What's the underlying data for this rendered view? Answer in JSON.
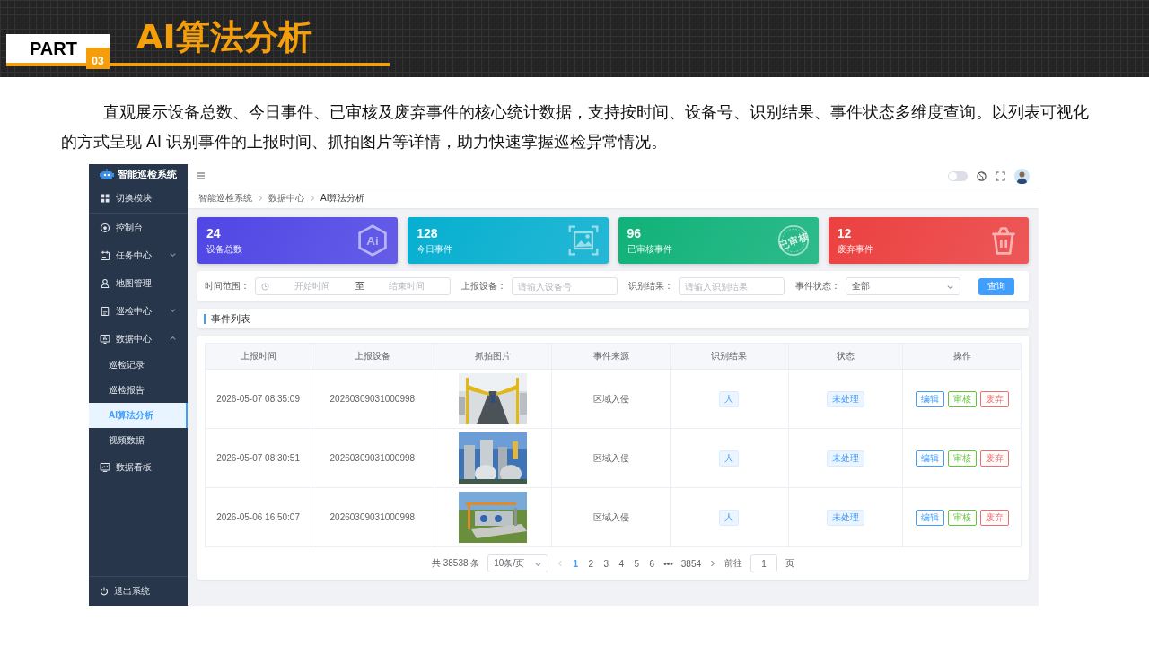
{
  "slide": {
    "part_label": "PART",
    "part_number": "03",
    "title": "AI算法分析",
    "description": "直观展示设备总数、今日事件、已审核及废弃事件的核心统计数据，支持按时间、设备号、识别结果、事件状态多维度查询。以列表可视化的方式呈现 AI 识别事件的上报时间、抓拍图片等详情，助力快速掌握巡检异常情况。"
  },
  "app": {
    "logo": "智能巡检系统",
    "menu": [
      {
        "label": "切换模块",
        "kind": "switch",
        "selected": false
      },
      {
        "label": "控制台",
        "kind": "link",
        "selected": false
      },
      {
        "label": "任务中心",
        "kind": "group",
        "expanded": false,
        "selected": false
      },
      {
        "label": "地图管理",
        "kind": "link",
        "selected": false
      },
      {
        "label": "巡检中心",
        "kind": "group",
        "expanded": false,
        "selected": false
      },
      {
        "label": "数据中心",
        "kind": "group",
        "expanded": true,
        "selected": false,
        "children": [
          {
            "label": "巡检记录",
            "selected": false
          },
          {
            "label": "巡检报告",
            "selected": false
          },
          {
            "label": "AI算法分析",
            "selected": true
          },
          {
            "label": "视频数据",
            "selected": false
          }
        ]
      },
      {
        "label": "数据看板",
        "kind": "link",
        "selected": false
      }
    ],
    "logout": "退出系统",
    "theme_switch": {
      "on": false
    },
    "breadcrumb": [
      "智能巡检系统",
      "数据中心",
      "AI算法分析"
    ],
    "stats": [
      {
        "value": "24",
        "label": "设备总数",
        "color": "#4f46e5",
        "icon_text": "Ai"
      },
      {
        "value": "128",
        "label": "今日事件",
        "color": "#06afd0"
      },
      {
        "value": "96",
        "label": "已审核事件",
        "color": "#10b27a",
        "icon_text": "已审核"
      },
      {
        "value": "12",
        "label": "废弃事件",
        "color": "#ec4040"
      }
    ],
    "filters": [
      {
        "kind": "daterange",
        "label": "时间范围：",
        "start_placeholder": "开始时间",
        "separator": "至",
        "end_placeholder": "结束时间"
      },
      {
        "kind": "input",
        "label": "上报设备：",
        "placeholder": "请输入设备号"
      },
      {
        "kind": "input",
        "label": "识别结果：",
        "placeholder": "请输入识别结果"
      },
      {
        "kind": "select",
        "label": "事件状态：",
        "value": "全部"
      }
    ],
    "search_button": "查询",
    "table": {
      "title": "事件列表",
      "columns": [
        "上报时间",
        "上报设备",
        "抓拍图片",
        "事件来源",
        "识别结果",
        "状态",
        "操作"
      ],
      "rows": [
        {
          "time": "2026-05-07 08:35:09",
          "device": "20260309031000998",
          "source": "区域入侵",
          "result": "人",
          "status": "未处理",
          "actions": [
            {
              "label": "编辑",
              "color": "#409eff"
            },
            {
              "label": "审核",
              "color": "#67c23a"
            },
            {
              "label": "废弃",
              "color": "#f56c6c"
            }
          ]
        },
        {
          "time": "2026-05-07 08:30:51",
          "device": "20260309031000998",
          "source": "区域入侵",
          "result": "人",
          "status": "未处理",
          "actions": [
            {
              "label": "编辑",
              "color": "#409eff"
            },
            {
              "label": "审核",
              "color": "#67c23a"
            },
            {
              "label": "废弃",
              "color": "#f56c6c"
            }
          ]
        },
        {
          "time": "2026-05-06 16:50:07",
          "device": "20260309031000998",
          "source": "区域入侵",
          "result": "人",
          "status": "未处理",
          "actions": [
            {
              "label": "编辑",
              "color": "#409eff"
            },
            {
              "label": "审核",
              "color": "#67c23a"
            },
            {
              "label": "废弃",
              "color": "#f56c6c"
            }
          ]
        }
      ]
    },
    "pagination": {
      "total": "共 38538 条",
      "page_size": "10条/页",
      "pages": [
        {
          "kind": "page",
          "label": "1",
          "selected": true
        },
        {
          "kind": "page",
          "label": "2",
          "selected": false
        },
        {
          "kind": "page",
          "label": "3",
          "selected": false
        },
        {
          "kind": "page",
          "label": "4",
          "selected": false
        },
        {
          "kind": "page",
          "label": "5",
          "selected": false
        },
        {
          "kind": "page",
          "label": "6",
          "selected": false
        },
        {
          "kind": "more",
          "label": "•••"
        },
        {
          "kind": "page",
          "label": "3854",
          "selected": false
        }
      ],
      "goto_label": "前往",
      "goto_value": "1",
      "goto_suffix": "页"
    }
  }
}
